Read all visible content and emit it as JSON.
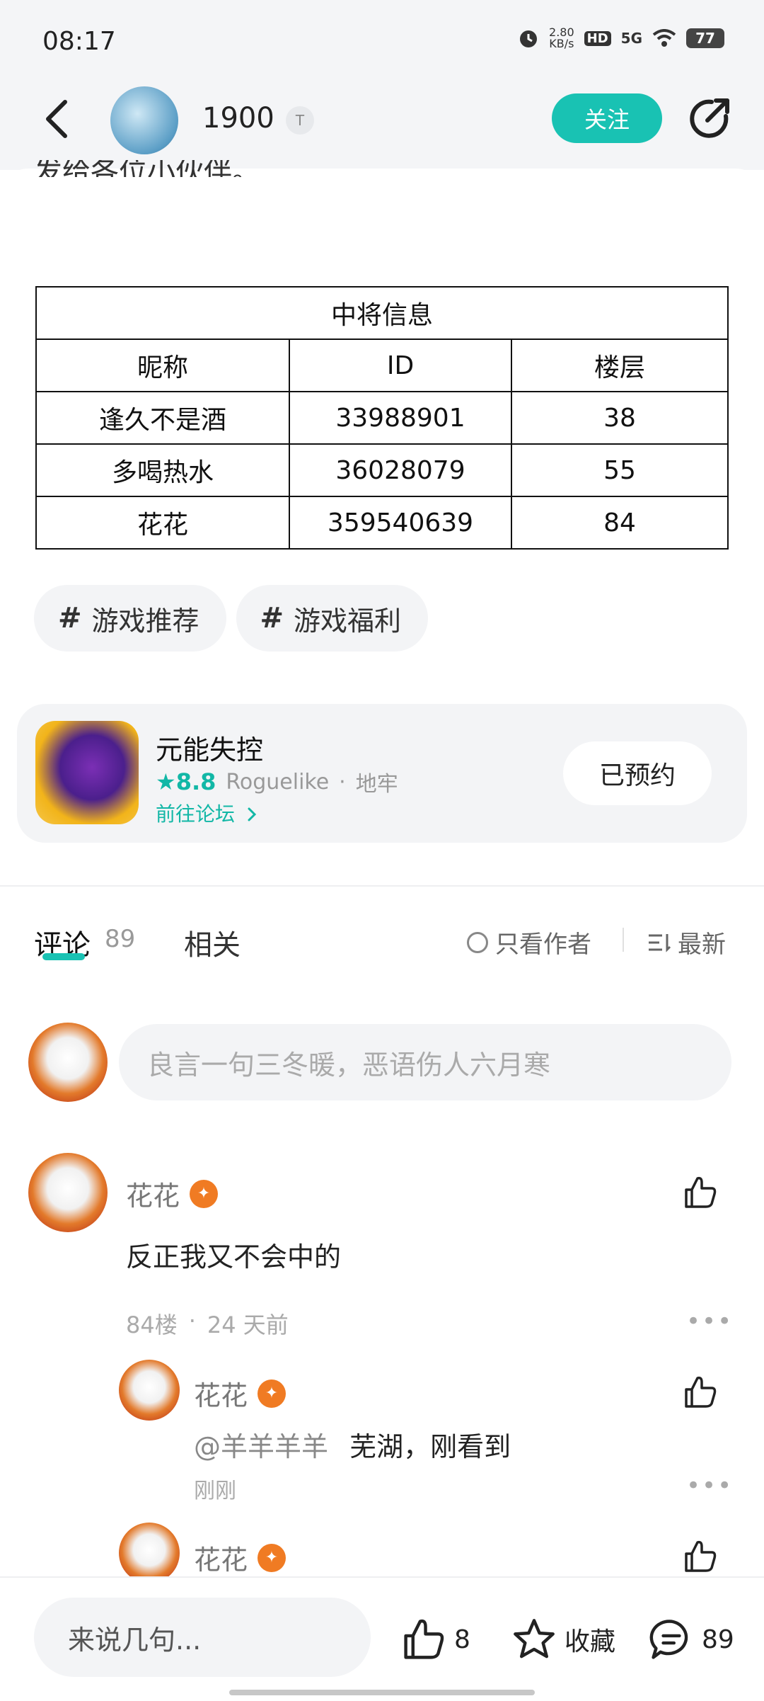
{
  "status_bar": {
    "time": "08:17",
    "net_speed": "2.80",
    "net_unit": "KB/s",
    "hd": "HD",
    "signal": "5G",
    "battery": "77"
  },
  "header": {
    "username": "1900",
    "level": "T",
    "follow_label": "关注"
  },
  "post": {
    "clipped_text": "发给各位小伙伴。",
    "table": {
      "title": "中将信息",
      "headers": [
        "昵称",
        "ID",
        "楼层"
      ],
      "rows": [
        [
          "逢久不是酒",
          "33988901",
          "38"
        ],
        [
          "多喝热水",
          "36028079",
          "55"
        ],
        [
          "花花",
          "359540639",
          "84"
        ]
      ]
    },
    "tags": [
      {
        "symbol": "#",
        "label": "游戏推荐"
      },
      {
        "symbol": "#",
        "label": "游戏福利"
      }
    ]
  },
  "game_card": {
    "title": "元能失控",
    "rating": "8.8",
    "genre": "Roguelike",
    "dot": "·",
    "sub_genre": "地牢",
    "forum_link": "前往论坛",
    "reserve_label": "已预约"
  },
  "comments_tabs": {
    "comment_label": "评论",
    "comment_count": "89",
    "related_label": "相关",
    "only_author": "只看作者",
    "sort_label": "最新"
  },
  "comment_input_placeholder": "良言一句三冬暖，恶语伤人六月寒",
  "comments": [
    {
      "user": "花花",
      "text": "反正我又不会中的",
      "floor": "84楼",
      "dot": "·",
      "time": "24 天前"
    }
  ],
  "replies": [
    {
      "user": "花花",
      "mention": "@羊羊羊羊",
      "text": "芜湖，刚看到",
      "time": "刚刚"
    },
    {
      "user": "花花"
    }
  ],
  "bottom_bar": {
    "input_placeholder": "来说几句...",
    "likes": "8",
    "collect_label": "收藏",
    "comments": "89"
  },
  "colors": {
    "accent": "#19c2b3",
    "medal": "#f07b23"
  },
  "icons": [
    "back-icon",
    "share-icon",
    "like-icon",
    "star-icon",
    "chat-icon",
    "sort-icon",
    "chevron-right-icon"
  ]
}
